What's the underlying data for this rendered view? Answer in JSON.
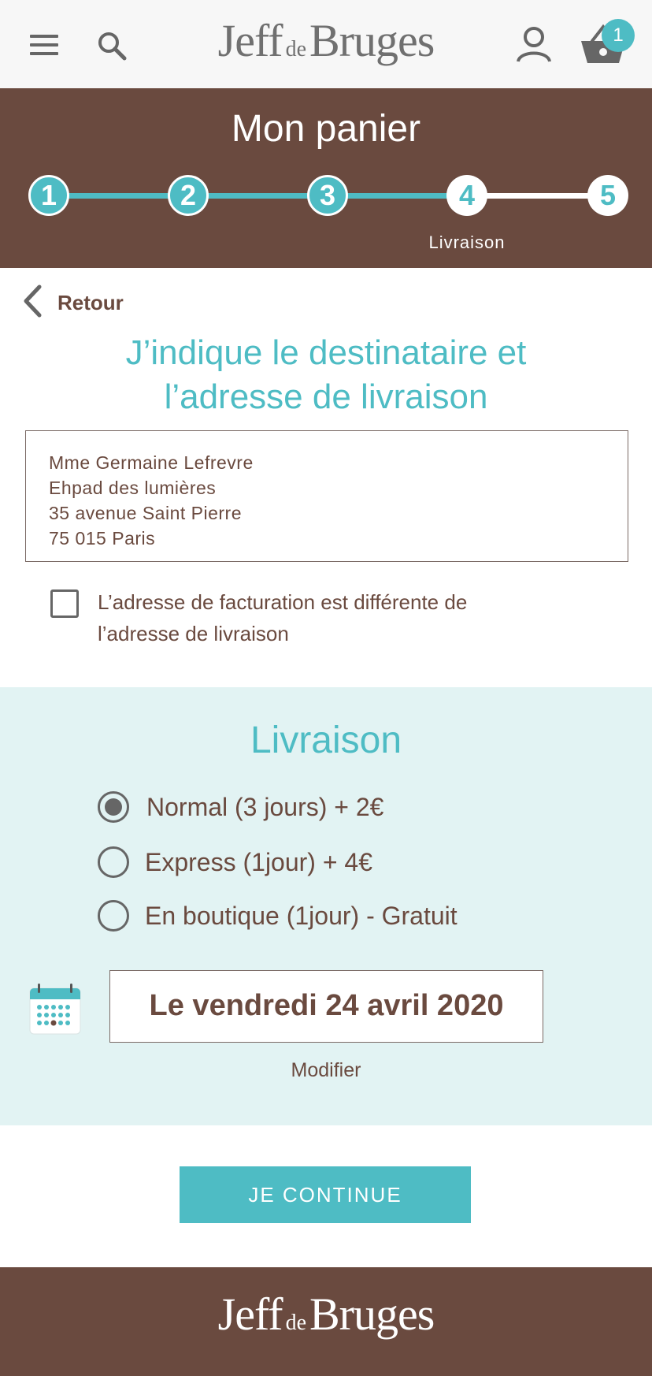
{
  "header": {
    "logo": {
      "part1": "Jeff",
      "part2": "de",
      "part3": "Bruges"
    },
    "cart_count": "1"
  },
  "progress": {
    "title": "Mon panier",
    "steps": [
      "1",
      "2",
      "3",
      "4",
      "5"
    ],
    "current_step": 4,
    "current_label": "Livraison"
  },
  "back": {
    "label": "Retour"
  },
  "recipient": {
    "title_line1": "J’indique le destinataire et",
    "title_line2": "l’adresse de livraison",
    "address": [
      "Mme Germaine Lefrevre",
      "Ehpad des lumières",
      "35 avenue Saint Pierre",
      "75 015 Paris"
    ],
    "billing_checkbox_line1": "L’adresse de facturation est différente de",
    "billing_checkbox_line2": "l’adresse de livraison",
    "billing_checked": false
  },
  "delivery": {
    "title": "Livraison",
    "options": [
      {
        "label": "Normal (3 jours) + 2€",
        "selected": true
      },
      {
        "label": "Express (1jour) + 4€",
        "selected": false
      },
      {
        "label": "En boutique (1jour) - Gratuit",
        "selected": false
      }
    ],
    "date": "Le vendredi 24 avril 2020",
    "modify_label": "Modifier"
  },
  "continue_label": "JE CONTINUE",
  "footer": {
    "logo": {
      "part1": "Jeff",
      "part2": "de",
      "part3": "Bruges"
    }
  },
  "colors": {
    "brand_brown": "#6a4a3f",
    "accent_teal": "#4ebcc4",
    "panel_bg": "#e2f3f3"
  },
  "icons": [
    "menu-icon",
    "search-icon",
    "user-icon",
    "basket-icon",
    "chevron-left-icon",
    "calendar-icon"
  ]
}
